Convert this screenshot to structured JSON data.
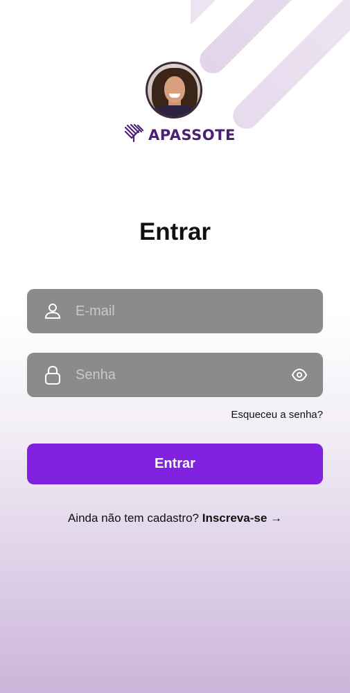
{
  "brand": {
    "name": "APASSOTE",
    "avatar_icon": "profile-photo",
    "logo_icon": "striped-leaf-icon",
    "color": "#4b2173"
  },
  "login": {
    "title": "Entrar",
    "email": {
      "placeholder": "E-mail",
      "value": "",
      "icon": "user-icon"
    },
    "password": {
      "placeholder": "Senha",
      "value": "",
      "icon": "lock-icon",
      "toggle_icon": "eye-icon"
    },
    "forgot_label": "Esqueceu a senha?",
    "submit_label": "Entrar",
    "signup_prompt": "Ainda não tem cadastro?",
    "signup_link": "Inscreva-se",
    "signup_arrow": "→"
  },
  "colors": {
    "accent": "#8022e0",
    "field_background": "#8b8b8b",
    "brand_text": "#4b2173"
  }
}
